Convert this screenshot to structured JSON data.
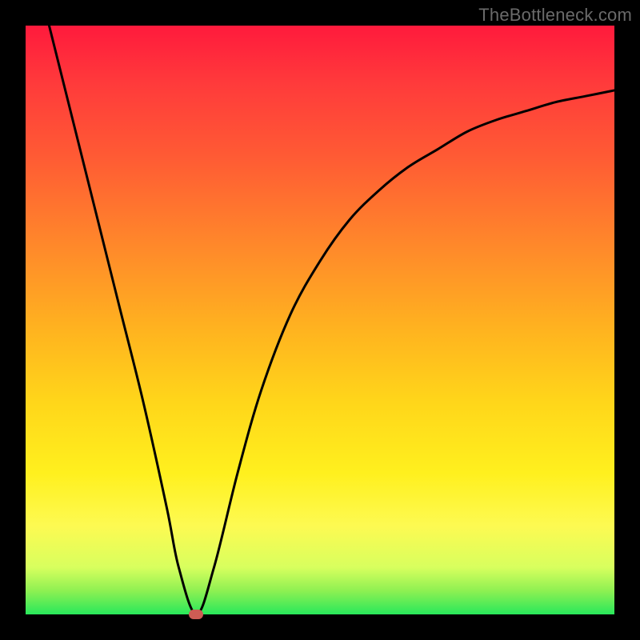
{
  "watermark": "TheBottleneck.com",
  "chart_data": {
    "type": "line",
    "title": "",
    "xlabel": "",
    "ylabel": "",
    "xlim": [
      0,
      100
    ],
    "ylim": [
      0,
      100
    ],
    "series": [
      {
        "name": "curve",
        "x": [
          4,
          8,
          12,
          16,
          20,
          24,
          26,
          29,
          32,
          36,
          40,
          45,
          50,
          55,
          60,
          65,
          70,
          75,
          80,
          85,
          90,
          95,
          100
        ],
        "y": [
          100,
          84,
          68,
          52,
          36,
          18,
          8,
          0,
          8,
          24,
          38,
          51,
          60,
          67,
          72,
          76,
          79,
          82,
          84,
          85.5,
          87,
          88,
          89
        ]
      }
    ],
    "marker": {
      "x": 29,
      "y": 0,
      "color": "#cd5c54"
    },
    "gradient_stops": [
      {
        "pct": 0,
        "color": "#ff1a3c"
      },
      {
        "pct": 10,
        "color": "#ff3b3b"
      },
      {
        "pct": 22,
        "color": "#ff5a34"
      },
      {
        "pct": 38,
        "color": "#ff8a2a"
      },
      {
        "pct": 52,
        "color": "#ffb41f"
      },
      {
        "pct": 64,
        "color": "#ffd61a"
      },
      {
        "pct": 76,
        "color": "#fff01e"
      },
      {
        "pct": 85,
        "color": "#fdfa52"
      },
      {
        "pct": 92,
        "color": "#d8ff5e"
      },
      {
        "pct": 96,
        "color": "#8ef052"
      },
      {
        "pct": 100,
        "color": "#28e85b"
      }
    ]
  }
}
